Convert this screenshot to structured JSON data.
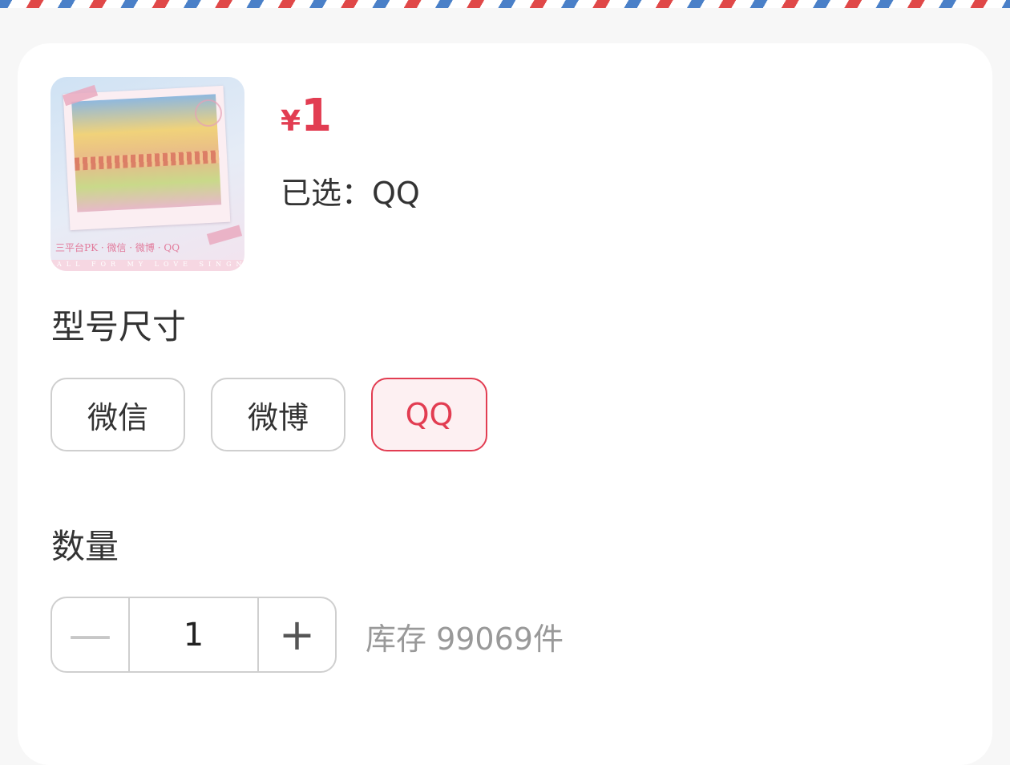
{
  "product": {
    "price_currency": "¥",
    "price_value": "1",
    "selected_label": "已选：",
    "selected_value": "QQ",
    "thumbnail_caption": "三平台PK · 微信 · 微博 · QQ",
    "thumbnail_subcaption": "ALL FOR MY LOVE SINGNING"
  },
  "spec": {
    "title": "型号尺寸",
    "options": [
      "微信",
      "微博",
      "QQ"
    ],
    "selected_option": "QQ"
  },
  "quantity": {
    "title": "数量",
    "minus": "—",
    "value": "1",
    "plus": "+",
    "stock_text": "库存 99069件"
  },
  "colors": {
    "accent": "#e23d52",
    "accent_bg": "#fdf0f2",
    "border": "#cfcfcf",
    "airmail_blue": "#4a80c8",
    "airmail_red": "#e04848"
  }
}
